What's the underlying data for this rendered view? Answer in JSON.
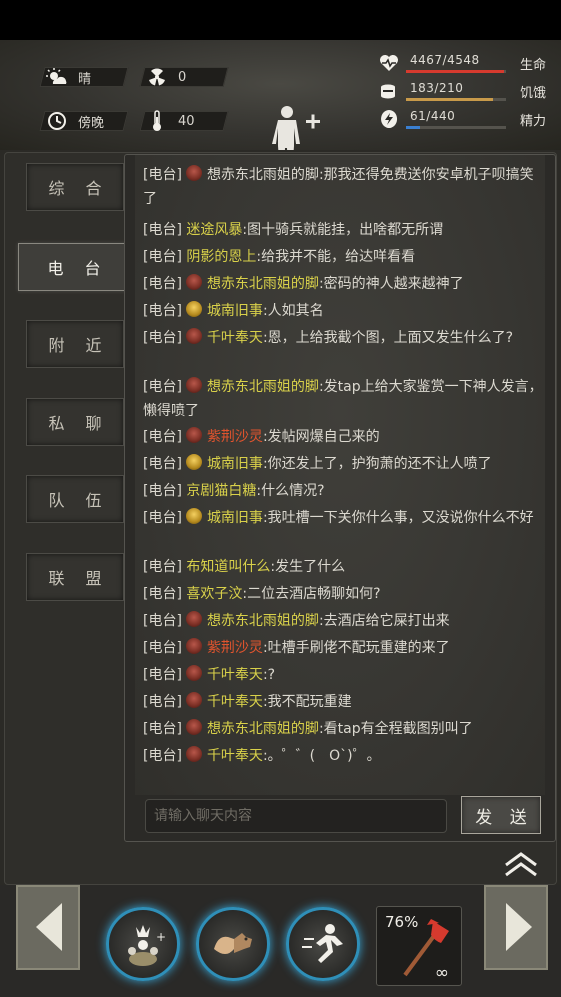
{
  "status": {
    "weather": "晴",
    "radiation": "0",
    "time_of_day": "傍晚",
    "temperature": "40",
    "stats": [
      {
        "name": "health",
        "value": "4467/4548",
        "label": "生命",
        "fill": 0.982,
        "color": "#d63a2e"
      },
      {
        "name": "hunger",
        "value": "183/210",
        "label": "饥饿",
        "fill": 0.871,
        "color": "#c89a4a"
      },
      {
        "name": "energy",
        "value": "61/440",
        "label": "精力",
        "fill": 0.139,
        "color": "#3a7fd0"
      }
    ]
  },
  "tabs": [
    "综 合",
    "电 台",
    "附 近",
    "私 聊",
    "队 伍",
    "联 盟"
  ],
  "active_tab": 1,
  "channel": "[电台]",
  "messages": [
    {
      "avatar": "red",
      "name": "想赤东北雨姐的脚",
      "color": "plain",
      "text": ":那我还得免费送你安卓机子呗搞笑了"
    },
    {
      "avatar": "none",
      "name": "迷途风暴",
      "color": "yel",
      "text": ":图十骑兵就能挂，出啥都无所谓"
    },
    {
      "avatar": "none",
      "name": "阴影的恩上",
      "color": "yel",
      "text": ":给我并不能，给达咩看看"
    },
    {
      "avatar": "red",
      "name": "想赤东北雨姐的脚",
      "color": "yel",
      "text": ":密码的神人越来越神了"
    },
    {
      "avatar": "gold",
      "name": "城南旧事",
      "color": "yel",
      "text": ":人如其名"
    },
    {
      "avatar": "red",
      "name": "千叶奉天",
      "color": "yel",
      "text": ":恩，上给我截个图，上面又发生什么了?"
    },
    {
      "avatar": "red",
      "name": "想赤东北雨姐的脚",
      "color": "yel",
      "text": ":发tap上给大家鉴赏一下神人发言，懒得喷了"
    },
    {
      "avatar": "red",
      "name": "紫荆沙灵",
      "color": "red",
      "text": ":发帖网爆自己来的"
    },
    {
      "avatar": "gold",
      "name": "城南旧事",
      "color": "yel",
      "text": ":你还发上了，护狗萧的还不让人喷了"
    },
    {
      "avatar": "none",
      "name": "京剧猫白糖",
      "color": "yel",
      "text": ":什么情况?"
    },
    {
      "avatar": "gold",
      "name": "城南旧事",
      "color": "yel",
      "text": ":我吐槽一下关你什么事，又没说你什么不好"
    },
    {
      "avatar": "none",
      "name": "布知道叫什么",
      "color": "yel",
      "text": ":发生了什么"
    },
    {
      "avatar": "none",
      "name": "喜欢子汶",
      "color": "yel",
      "text": ":二位去酒店畅聊如何?"
    },
    {
      "avatar": "red",
      "name": "想赤东北雨姐的脚",
      "color": "yel",
      "text": ":去酒店给它屎打出来"
    },
    {
      "avatar": "red",
      "name": "紫荆沙灵",
      "color": "red",
      "text": ":吐槽手刷佬不配玩重建的来了"
    },
    {
      "avatar": "red",
      "name": "千叶奉天",
      "color": "yel",
      "text": ":?"
    },
    {
      "avatar": "red",
      "name": "千叶奉天",
      "color": "yel",
      "text": ":我不配玩重建"
    },
    {
      "avatar": "red",
      "name": "想赤东北雨姐的脚",
      "color": "yel",
      "text": ":看tap有全程截图别叫了"
    },
    {
      "avatar": "red",
      "name": "千叶奉天",
      "color": "yel",
      "text": ":。゜゛(　O`)゜。"
    }
  ],
  "chat_input": {
    "placeholder": "请输入聊天内容"
  },
  "send_label": "发 送",
  "weapon": {
    "durability": "76%",
    "ammo": "∞"
  }
}
